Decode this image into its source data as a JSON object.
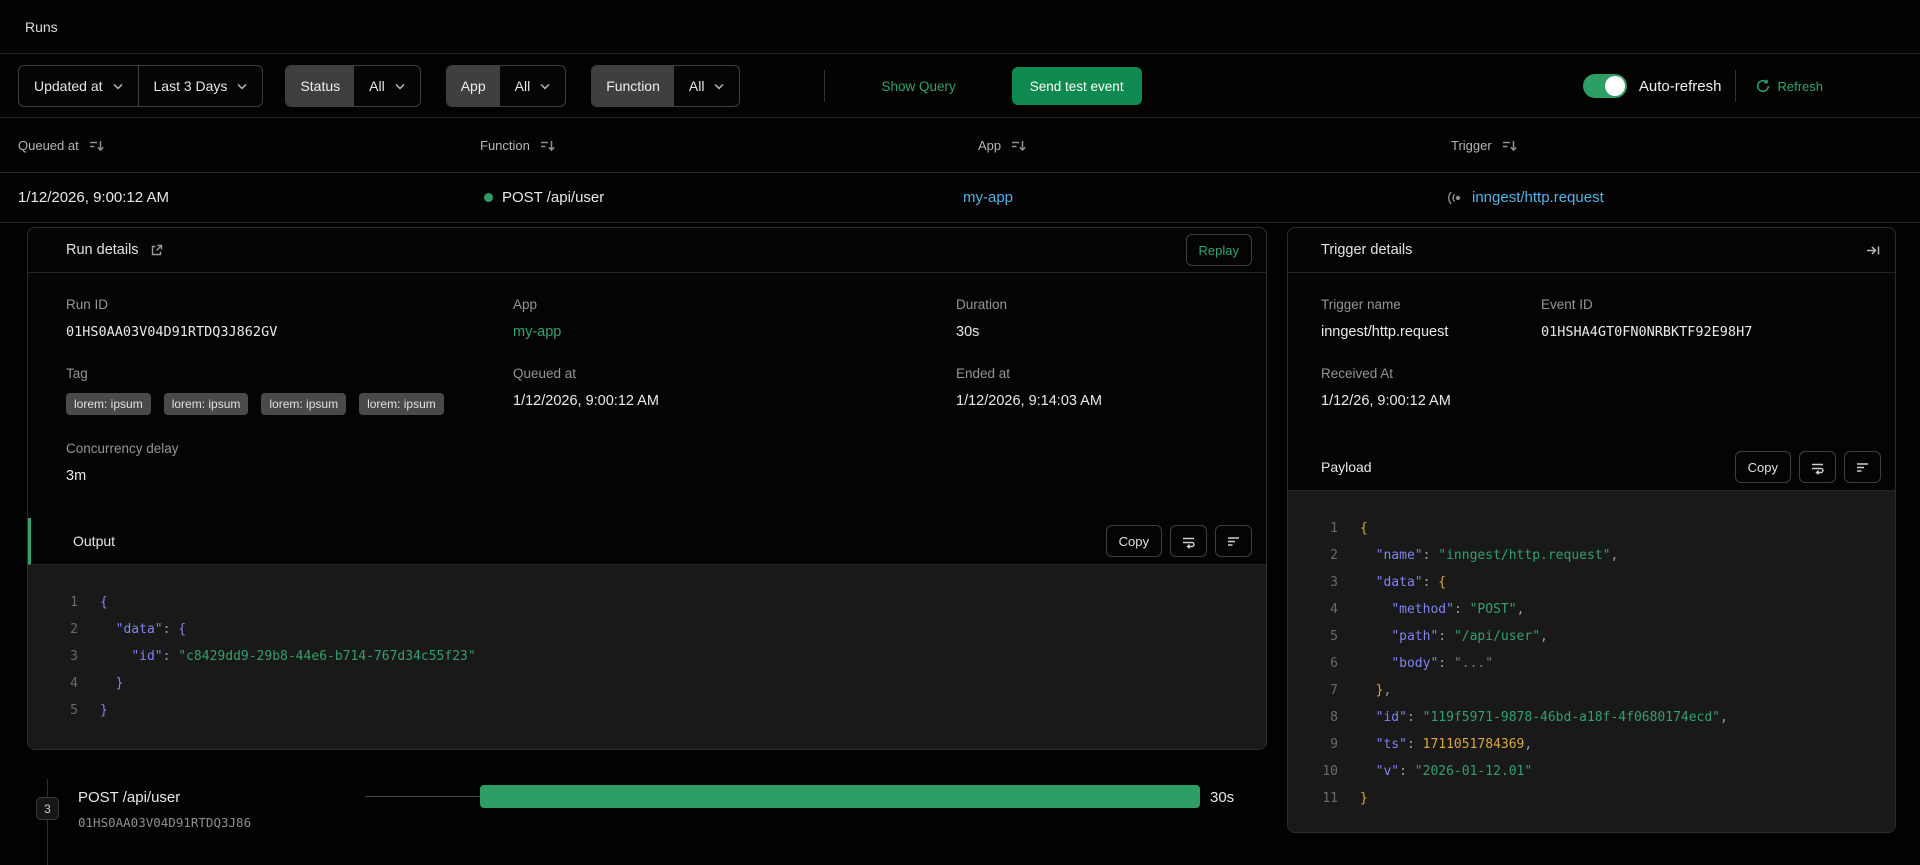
{
  "page": {
    "title": "Runs"
  },
  "colors": {
    "accent_green": "#2fa46c",
    "button_green": "#0e8a50",
    "bar_green": "#2f9e64",
    "link_blue": "#57b2e6",
    "code_key": "#8183f0",
    "code_string": "#33a06b",
    "code_orange": "#dda73e"
  },
  "filters": {
    "sort_field": "Updated at",
    "time_range": "Last 3 Days",
    "status_label": "Status",
    "status_value": "All",
    "app_label": "App",
    "app_value": "All",
    "function_label": "Function",
    "function_value": "All",
    "show_query": "Show Query",
    "send_test_event": "Send test event",
    "auto_refresh_label": "Auto-refresh",
    "refresh_label": "Refresh"
  },
  "table": {
    "headers": {
      "queued_at": "Queued at",
      "function": "Function",
      "app": "App",
      "trigger": "Trigger"
    },
    "row": {
      "queued_at": "1/12/2026, 9:00:12 AM",
      "function": "POST /api/user",
      "app": "my-app",
      "trigger": "inngest/http.request"
    }
  },
  "run_details": {
    "title": "Run details",
    "replay_label": "Replay",
    "run_id_label": "Run ID",
    "run_id": "01HS0AA03V04D91RTDQ3J862GV",
    "app_label": "App",
    "app": "my-app",
    "duration_label": "Duration",
    "duration": "30s",
    "tag_label": "Tag",
    "tags": [
      "lorem: ipsum",
      "lorem: ipsum",
      "lorem: ipsum",
      "lorem: ipsum"
    ],
    "queued_at_label": "Queued at",
    "queued_at": "1/12/2026, 9:00:12 AM",
    "ended_at_label": "Ended at",
    "ended_at": "1/12/2026, 9:14:03 AM",
    "concurrency_label": "Concurrency delay",
    "concurrency": "3m",
    "output": {
      "title": "Output",
      "copy_label": "Copy",
      "lines": [
        [
          [
            "{",
            "bi"
          ]
        ],
        [
          [
            "  ",
            ""
          ],
          [
            "\"data\"",
            "k"
          ],
          [
            ": ",
            "p"
          ],
          [
            "{",
            "bi"
          ]
        ],
        [
          [
            "    ",
            ""
          ],
          [
            "\"id\"",
            "k"
          ],
          [
            ": ",
            "p"
          ],
          [
            "\"c8429dd9-29b8-44e6-b714-767d34c55f23\"",
            "s"
          ]
        ],
        [
          [
            "  ",
            ""
          ],
          [
            "}",
            "bi"
          ]
        ],
        [
          [
            "}",
            "bi"
          ]
        ]
      ]
    }
  },
  "trigger_details": {
    "title": "Trigger details",
    "trigger_name_label": "Trigger name",
    "trigger_name": "inngest/http.request",
    "event_id_label": "Event ID",
    "event_id": "01HSHA4GT0FN0NRBKTF92E98H7",
    "received_at_label": "Received At",
    "received_at": "1/12/26, 9:00:12 AM",
    "payload": {
      "title": "Payload",
      "copy_label": "Copy",
      "lines": [
        [
          [
            "{",
            "bo"
          ]
        ],
        [
          [
            "  ",
            ""
          ],
          [
            "\"name\"",
            "k"
          ],
          [
            ": ",
            "p"
          ],
          [
            "\"inngest/http.request\"",
            "s"
          ],
          [
            ",",
            "p"
          ]
        ],
        [
          [
            "  ",
            ""
          ],
          [
            "\"data\"",
            "k"
          ],
          [
            ": ",
            "p"
          ],
          [
            "{",
            "bo"
          ]
        ],
        [
          [
            "    ",
            ""
          ],
          [
            "\"method\"",
            "k"
          ],
          [
            ": ",
            "p"
          ],
          [
            "\"POST\"",
            "s"
          ],
          [
            ",",
            "p"
          ]
        ],
        [
          [
            "    ",
            ""
          ],
          [
            "\"path\"",
            "k"
          ],
          [
            ": ",
            "p"
          ],
          [
            "\"/api/user\"",
            "s"
          ],
          [
            ",",
            "p"
          ]
        ],
        [
          [
            "    ",
            ""
          ],
          [
            "\"body\"",
            "k"
          ],
          [
            ": ",
            "p"
          ],
          [
            "\"...\"",
            "m"
          ]
        ],
        [
          [
            "  ",
            ""
          ],
          [
            "}",
            "bo"
          ],
          [
            ",",
            "p"
          ]
        ],
        [
          [
            "  ",
            ""
          ],
          [
            "\"id\"",
            "k"
          ],
          [
            ": ",
            "p"
          ],
          [
            "\"119f5971-9878-46bd-a18f-4f0680174ecd\"",
            "s"
          ],
          [
            ",",
            "p"
          ]
        ],
        [
          [
            "  ",
            ""
          ],
          [
            "\"ts\"",
            "k"
          ],
          [
            ": ",
            "p"
          ],
          [
            "1711051784369",
            "n"
          ],
          [
            ",",
            "p"
          ]
        ],
        [
          [
            "  ",
            ""
          ],
          [
            "\"v\"",
            "k"
          ],
          [
            ": ",
            "p"
          ],
          [
            "\"2026-01-12.01\"",
            "s"
          ]
        ],
        [
          [
            "}",
            "bo"
          ]
        ]
      ]
    }
  },
  "timeline": {
    "step_number": "3",
    "function": "POST /api/user",
    "run_id": "01HS0AA03V04D91RTDQ3J86",
    "duration": "30s"
  }
}
